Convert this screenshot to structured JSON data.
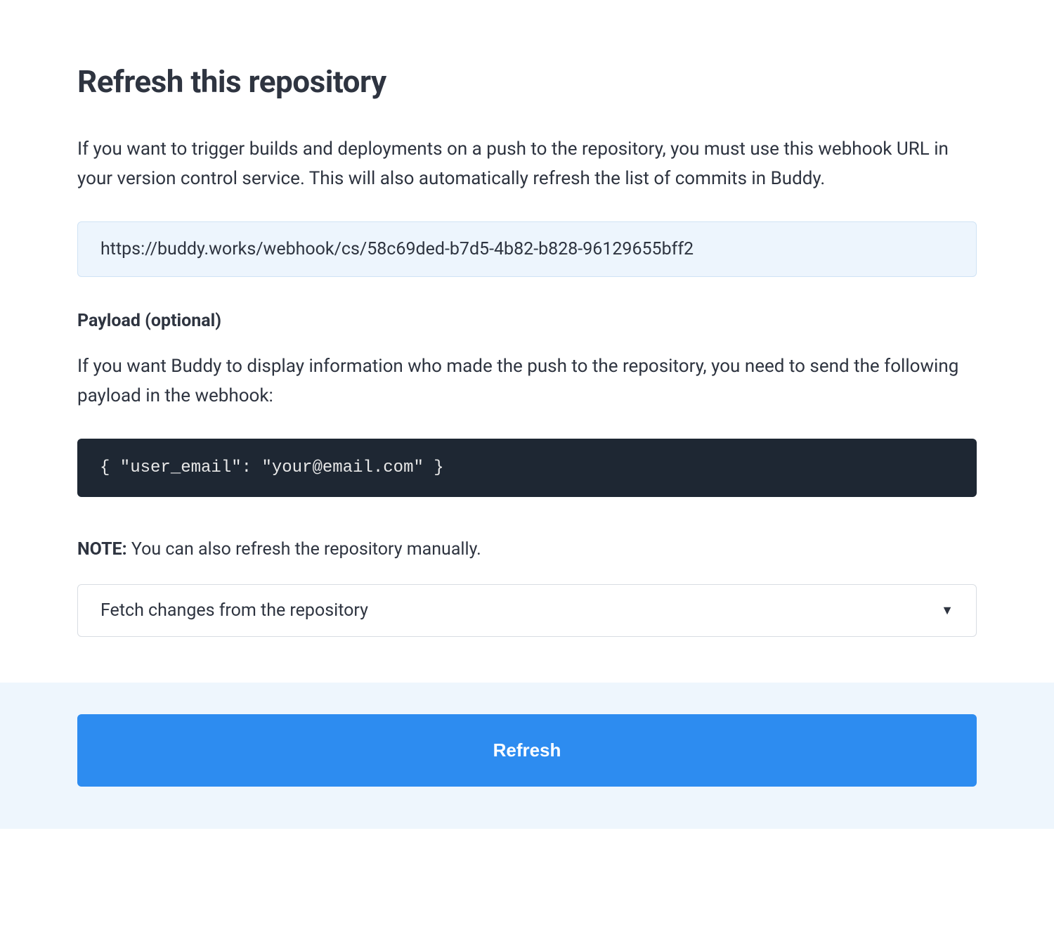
{
  "header": {
    "title": "Refresh this repository"
  },
  "description": "If you want to trigger builds and deployments on a push to the repository, you must use this webhook URL in your version control service. This will also automatically refresh the list of commits in Buddy.",
  "webhook": {
    "url": "https://buddy.works/webhook/cs/58c69ded-b7d5-4b82-b828-96129655bff2"
  },
  "payload": {
    "title": "Payload (optional)",
    "description": "If you want Buddy to display information who made the push to the repository, you need to send the following payload in the webhook:",
    "code": "{ \"user_email\": \"your@email.com\" }"
  },
  "note": {
    "label": "NOTE:",
    "text": " You can also refresh the repository manually."
  },
  "select": {
    "selected": "Fetch changes from the repository"
  },
  "actions": {
    "refresh_label": "Refresh"
  }
}
